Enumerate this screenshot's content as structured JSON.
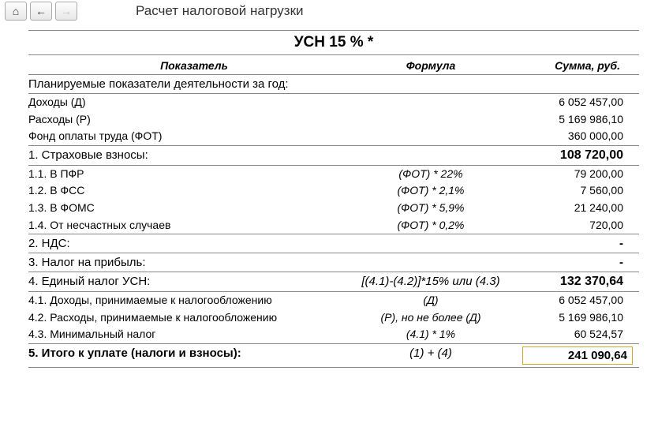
{
  "toolbar": {
    "home_icon": "⌂",
    "back_icon": "←",
    "forward_icon": "→"
  },
  "page_title": "Расчет налоговой нагрузки",
  "main_title": "УСН 15 % *",
  "column_headers": {
    "indicator": "Показатель",
    "formula": "Формула",
    "sum": "Сумма, руб."
  },
  "planned_section": {
    "title": "Планируемые показатели деятельности за год:"
  },
  "rows": {
    "income": {
      "label": "Доходы (Д)",
      "formula": "",
      "value": "6 052 457,00"
    },
    "expenses": {
      "label": "Расходы (Р)",
      "formula": "",
      "value": "5 169 986,10"
    },
    "fot": {
      "label": "Фонд оплаты труда (ФОТ)",
      "formula": "",
      "value": "360 000,00"
    }
  },
  "section1": {
    "title": "1. Страховые взносы:",
    "value": "108 720,00"
  },
  "rows1": {
    "pfr": {
      "label": "1.1. В ПФР",
      "formula": "(ФОТ) * 22%",
      "value": "79 200,00"
    },
    "fss": {
      "label": "1.2. В ФСС",
      "formula": "(ФОТ) * 2,1%",
      "value": "7 560,00"
    },
    "foms": {
      "label": "1.3. В ФОМС",
      "formula": "(ФОТ) * 5,9%",
      "value": "21 240,00"
    },
    "accidents": {
      "label": "1.4. От несчастных случаев",
      "formula": "(ФОТ) * 0,2%",
      "value": "720,00"
    }
  },
  "section2": {
    "title": "2. НДС:",
    "value": "-"
  },
  "section3": {
    "title": "3. Налог на прибыль:",
    "value": "-"
  },
  "section4": {
    "title": "4. Единый налог УСН:",
    "formula": "[(4.1)-(4.2)]*15% или (4.3)",
    "value": "132 370,64"
  },
  "rows4": {
    "income_tax": {
      "label": "4.1. Доходы, принимаемые к налогообложению",
      "formula": "(Д)",
      "value": "6 052 457,00"
    },
    "expense_tax": {
      "label": "4.2. Расходы, принимаемые к налогообложению",
      "formula": "(Р), но не более (Д)",
      "value": "5 169 986,10"
    },
    "min_tax": {
      "label": "4.3. Минимальный налог",
      "formula": "(4.1) * 1%",
      "value": "60 524,57"
    }
  },
  "section5": {
    "title": "5. Итого к уплате (налоги и взносы):",
    "formula": "(1) + (4)",
    "value": "241 090,64"
  }
}
